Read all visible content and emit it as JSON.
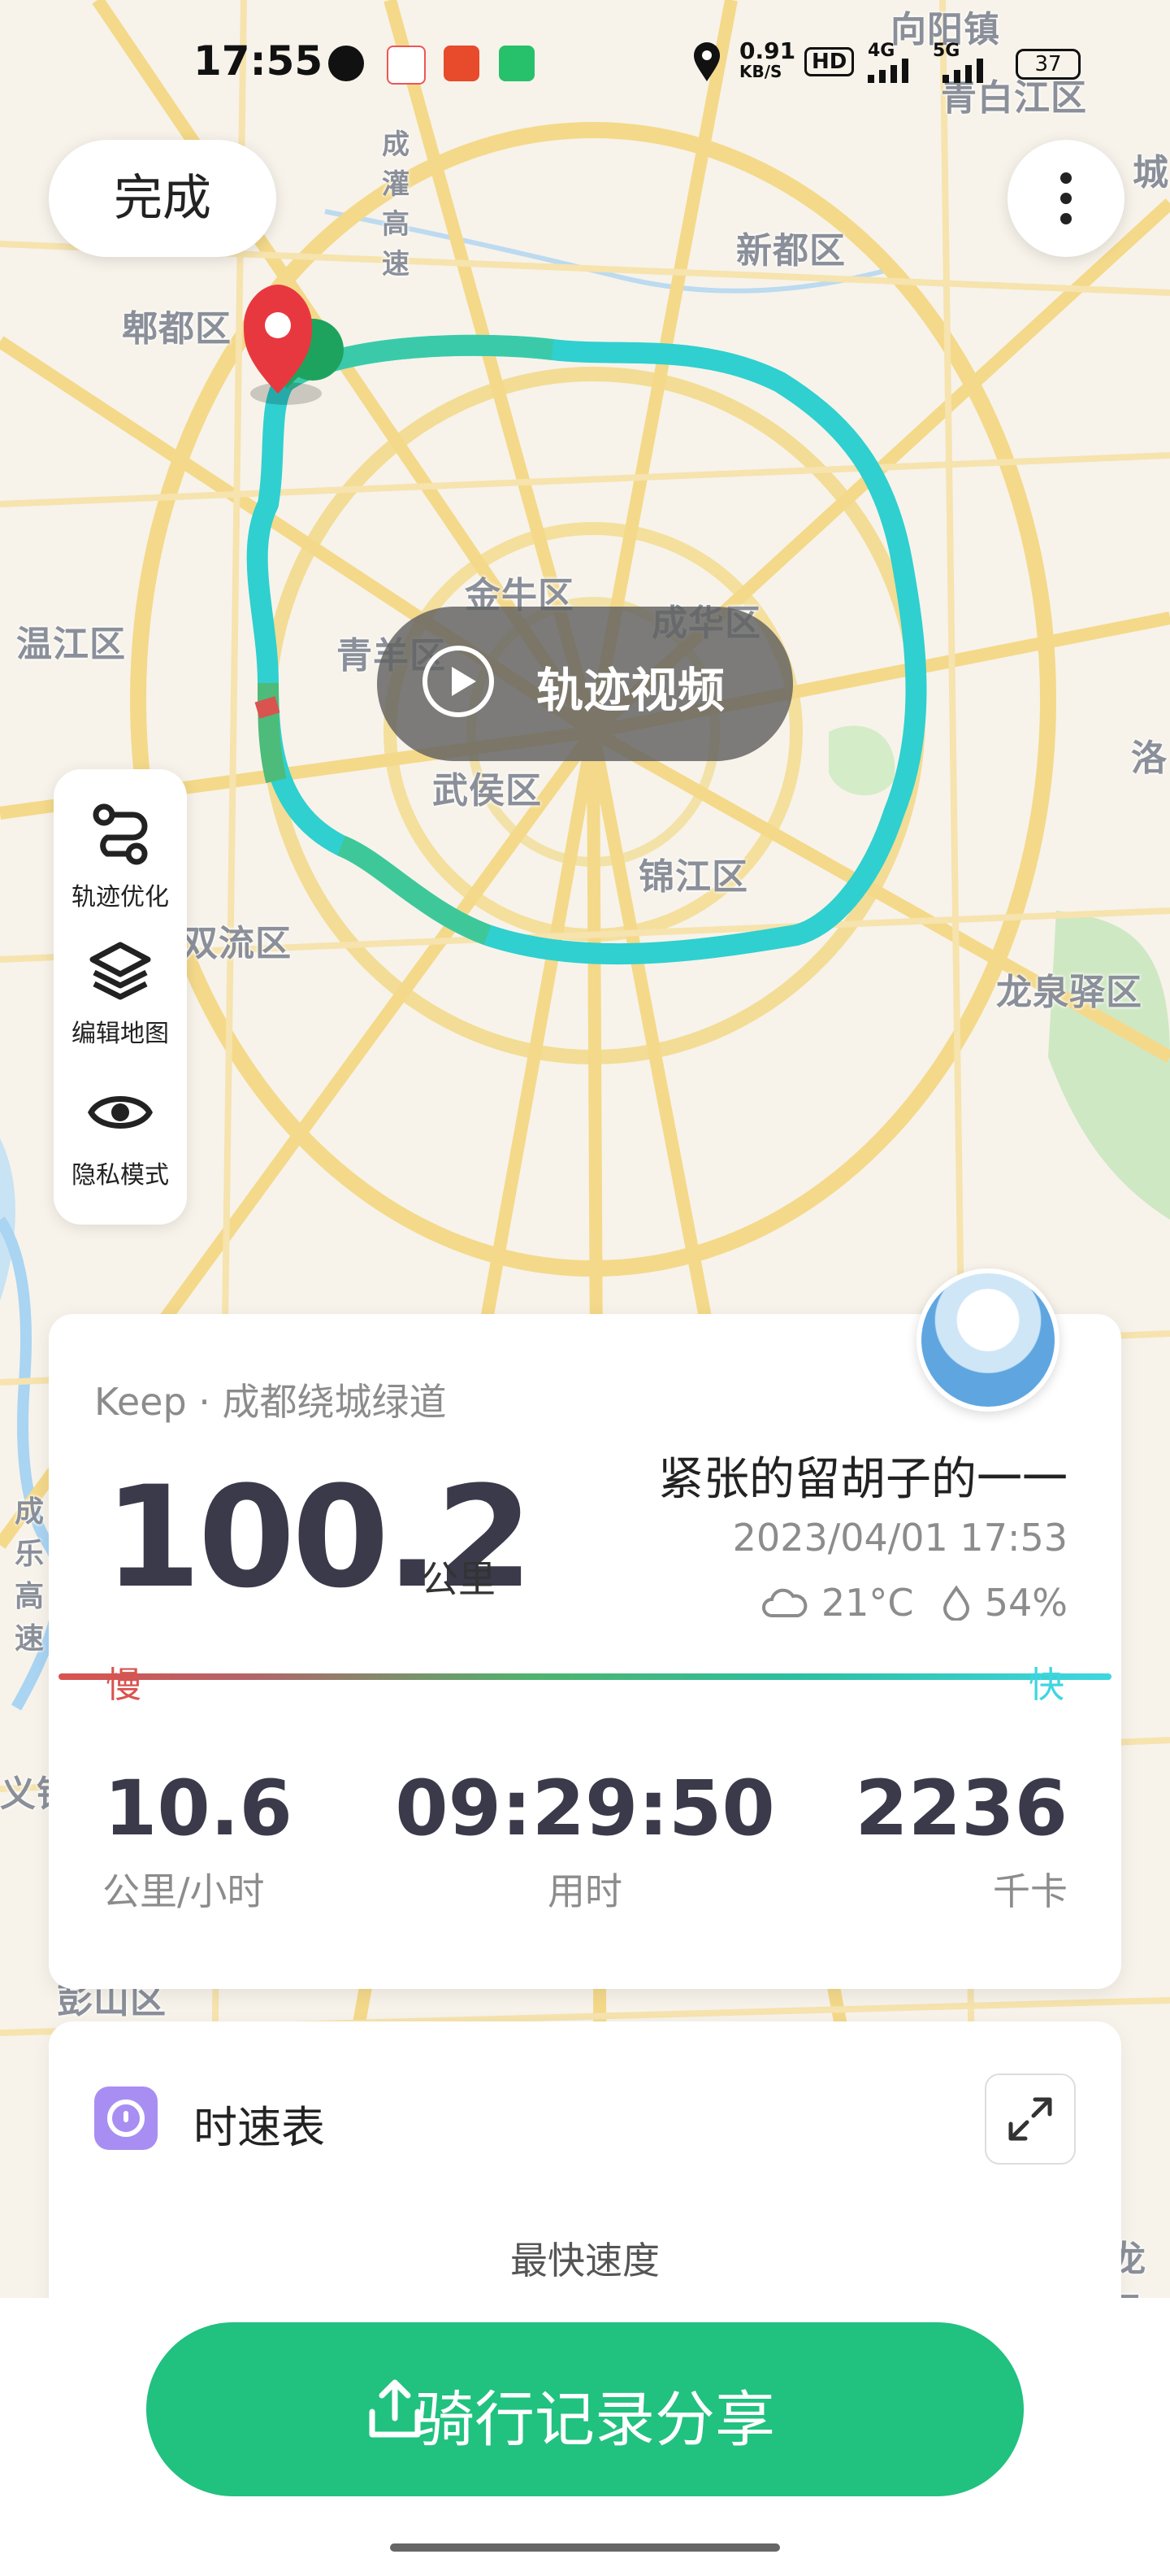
{
  "status_bar": {
    "time": "17:55",
    "net_speed": "0.91",
    "net_unit": "KB/S",
    "hd_label": "HD",
    "signal_4g": "4G",
    "signal_5g": "5G",
    "battery": "37"
  },
  "header": {
    "done_label": "完成",
    "more_icon": "more-vertical-icon"
  },
  "map": {
    "districts": [
      "向阳镇",
      "青白江区",
      "郫都区",
      "新都区",
      "城",
      "温江区",
      "金牛区",
      "成华区",
      "青羊区",
      "武侯区",
      "洛",
      "锦江区",
      "双流区",
      "龙泉驿区",
      "彭山区",
      "龙马",
      "成乐高速",
      "义镇"
    ],
    "highway_label": "成灌高速"
  },
  "video_button": {
    "label": "轨迹视频",
    "icon": "play-icon"
  },
  "tools": [
    {
      "label": "轨迹优化",
      "icon": "route-icon"
    },
    {
      "label": "编辑地图",
      "icon": "layers-icon"
    },
    {
      "label": "隐私模式",
      "icon": "eye-icon"
    }
  ],
  "summary": {
    "route_name": "Keep · 成都绕城绿道",
    "distance": "100.2",
    "distance_unit": "公里",
    "user_name": "紧张的留胡子的一一",
    "datetime": "2023/04/01 17:53",
    "temperature": "21°C",
    "humidity": "54%",
    "slow_label": "慢",
    "fast_label": "快",
    "stats": [
      {
        "value": "10.6",
        "label": "公里/小时"
      },
      {
        "value": "09:29:50",
        "label": "用时"
      },
      {
        "value": "2236",
        "label": "千卡"
      }
    ]
  },
  "speedometer": {
    "title": "时速表",
    "fastest_label": "最快速度"
  },
  "share": {
    "label": "骑行记录分享",
    "icon": "share-icon"
  },
  "colors": {
    "accent": "#21c17f",
    "slow": "#d9534f",
    "fast": "#3fd6e0"
  }
}
